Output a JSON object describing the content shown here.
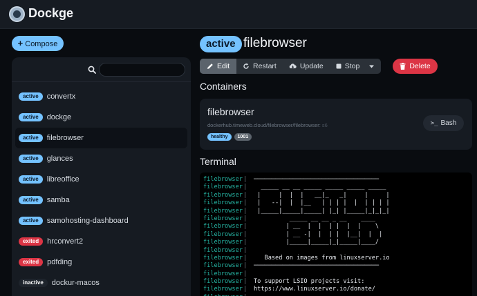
{
  "app": {
    "title": "Dockge"
  },
  "sidebar": {
    "compose_label": "Compose",
    "search": {
      "value": "",
      "placeholder": ""
    },
    "stacks": [
      {
        "status": "active",
        "name": "convertx"
      },
      {
        "status": "active",
        "name": "dockge"
      },
      {
        "status": "active",
        "name": "filebrowser",
        "selected": true
      },
      {
        "status": "active",
        "name": "glances"
      },
      {
        "status": "active",
        "name": "libreoffice"
      },
      {
        "status": "active",
        "name": "samba"
      },
      {
        "status": "active",
        "name": "samohosting-dashboard"
      },
      {
        "status": "exited",
        "name": "hrconvert2"
      },
      {
        "status": "exited",
        "name": "pdfding"
      },
      {
        "status": "inactive",
        "name": "dockur-macos"
      }
    ]
  },
  "stack": {
    "status": "active",
    "name": "filebrowser",
    "toolbar": {
      "edit": "Edit",
      "restart": "Restart",
      "update": "Update",
      "stop": "Stop",
      "delete": "Delete"
    }
  },
  "containers": {
    "title": "Containers",
    "items": [
      {
        "name": "filebrowser",
        "image": "dockerhub.timeweb.cloud/filebrowser/filebrowser:",
        "tag": "s6",
        "health": "healthy",
        "port": "1001",
        "bash_label": "Bash"
      }
    ]
  },
  "terminal": {
    "title": "Terminal",
    "service": "filebrowser",
    "separator": "|",
    "lines": [
      "───────────────────────────────────",
      "  _____ __ __ _____ _____ _____ _____",
      " |     |  |  |   __|_   _|     |     |",
      " |   --|  |  |__   | | | |  |  | | | |",
      " |_____|_____|_____| |_| |_____|_|_|_|",
      "          _____ __ __ _ __    ____",
      "         | __  |  |  | |  |  |    \\",
      "         | __ -|  |  | |  |__|  |  |",
      "         |_____|_____|_|_____|____/",
      "",
      "   Based on images from linuxserver.io",
      "───────────────────────────────────",
      "",
      "To support LSIO projects visit:",
      "https://www.linuxserver.io/donate/",
      ""
    ]
  },
  "colors": {
    "accent": "#74c2ff",
    "danger": "#dc3545",
    "terminal_service": "#26b5a4"
  }
}
